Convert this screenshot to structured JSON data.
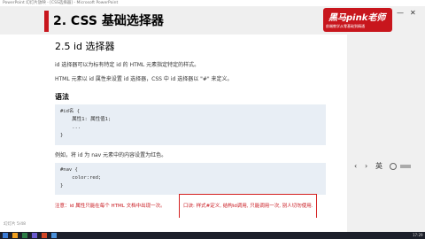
{
  "window": {
    "title": "PowerPoint 幻灯片放映 - [CSS选择器] - Microsoft PowerPoint"
  },
  "slide": {
    "title": "2. CSS 基础选择器",
    "section": "2.5 id 选择器",
    "para1": "id 选择器可以为标有特定 id 的 HTML 元素指定特定的样式。",
    "para2": "HTML 元素以 id 属性来设置 id 选择器，CSS 中 id 选择器以 \"#\" 来定义。",
    "syntax_heading": "语法",
    "code1": [
      "#id名 {",
      "    属性1: 属性值1;",
      "    ...",
      "}"
    ],
    "example_text": "例如，将 id 为 nav 元素中的内容设置为红色。",
    "code2": [
      "#nav {",
      "    color:red;",
      "}"
    ],
    "note": "注意：id 属性只能在每个 HTML 文档中出现一次。",
    "annotation": "口诀: 样式#定义, 结构id调用, 只能调用一次, 别人切勿使用."
  },
  "logo": {
    "brand": "黑马pink老师",
    "slogan": "前端教学从零基础到精通"
  },
  "controls": {
    "close": "✕",
    "minimize": "—",
    "prev": "‹",
    "next": "›",
    "lang": "英"
  },
  "status": {
    "slide_info": "幻灯片 5/48"
  },
  "taskbar": {
    "time": "17:29"
  },
  "colors": {
    "accent": "#c8161d",
    "header_band": "#efefef",
    "code_bg": "#e8eef5"
  }
}
